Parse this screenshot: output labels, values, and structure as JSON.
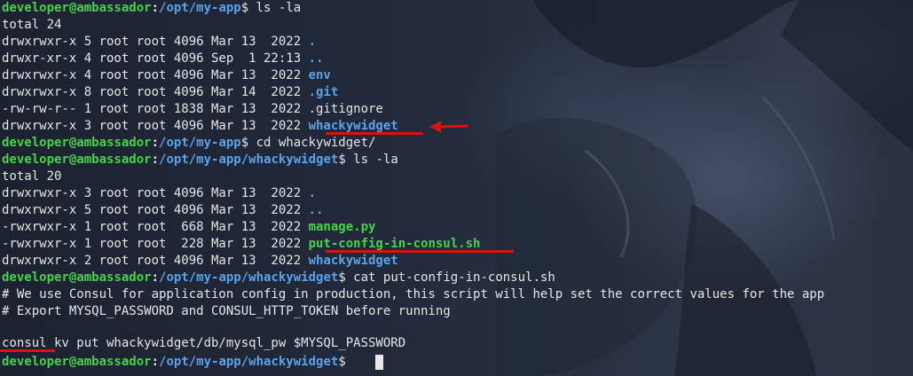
{
  "prompt": {
    "user": "developer@ambassador",
    "sep": ":",
    "suffix": "$ "
  },
  "lines": [
    {
      "type": "prompt",
      "path": "/opt/my-app",
      "cmd": "ls -la"
    },
    {
      "type": "text",
      "text": "total 24"
    },
    {
      "type": "entry",
      "meta": "drwxrwxr-x 5 root root 4096 Mar 13  2022 ",
      "name": ".",
      "kind": "dir"
    },
    {
      "type": "entry",
      "meta": "drwxr-xr-x 4 root root 4096 Sep  1 22:13 ",
      "name": "..",
      "kind": "dir"
    },
    {
      "type": "entry",
      "meta": "drwxrwxr-x 4 root root 4096 Mar 13  2022 ",
      "name": "env",
      "kind": "dir"
    },
    {
      "type": "entry",
      "meta": "drwxrwxr-x 8 root root 4096 Mar 14  2022 ",
      "name": ".git",
      "kind": "dir"
    },
    {
      "type": "entry",
      "meta": "-rw-rw-r-- 1 root root 1838 Mar 13  2022 ",
      "name": ".gitignore",
      "kind": "file"
    },
    {
      "type": "entry",
      "meta": "drwxrwxr-x 3 root root 4096 Mar 13  2022 ",
      "name": "whackywidget",
      "kind": "dir"
    },
    {
      "type": "prompt",
      "path": "/opt/my-app",
      "cmd": "cd whackywidget/"
    },
    {
      "type": "prompt",
      "path": "/opt/my-app/whackywidget",
      "cmd": "ls -la"
    },
    {
      "type": "text",
      "text": "total 20"
    },
    {
      "type": "entry",
      "meta": "drwxrwxr-x 3 root root 4096 Mar 13  2022 ",
      "name": ".",
      "kind": "dir"
    },
    {
      "type": "entry",
      "meta": "drwxrwxr-x 5 root root 4096 Mar 13  2022 ",
      "name": "..",
      "kind": "dir"
    },
    {
      "type": "entry",
      "meta": "-rwxrwxr-x 1 root root  668 Mar 13  2022 ",
      "name": "manage.py",
      "kind": "exec"
    },
    {
      "type": "entry",
      "meta": "-rwxrwxr-x 1 root root  228 Mar 13  2022 ",
      "name": "put-config-in-consul.sh",
      "kind": "exec"
    },
    {
      "type": "entry",
      "meta": "drwxrwxr-x 2 root root 4096 Mar 13  2022 ",
      "name": "whackywidget",
      "kind": "dir"
    },
    {
      "type": "prompt",
      "path": "/opt/my-app/whackywidget",
      "cmd": "cat put-config-in-consul.sh"
    },
    {
      "type": "text",
      "text": "# We use Consul for application config in production, this script will help set the correct values for the app"
    },
    {
      "type": "text",
      "text": "# Export MYSQL_PASSWORD and CONSUL_HTTP_TOKEN before running"
    },
    {
      "type": "text",
      "text": ""
    },
    {
      "type": "text",
      "text": "consul kv put whackywidget/db/mysql_pw $MYSQL_PASSWORD"
    },
    {
      "type": "prompt",
      "path": "/opt/my-app/whackywidget",
      "cmd": "",
      "cursor": true
    }
  ],
  "colors": {
    "user": "#44d34a",
    "path": "#5aa3e8",
    "annotation": "#e01010"
  }
}
